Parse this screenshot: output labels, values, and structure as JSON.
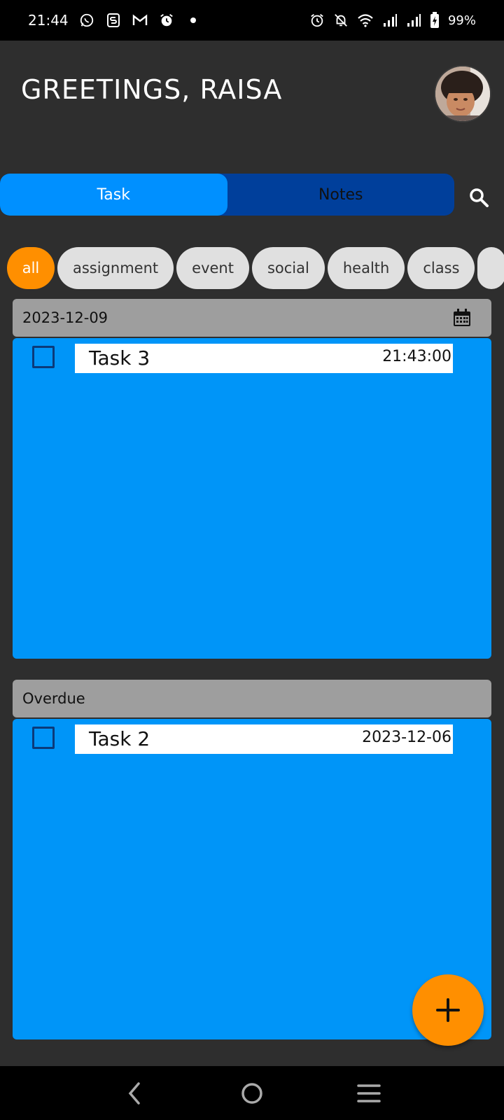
{
  "status_bar": {
    "time": "21:44",
    "battery": "99%",
    "left_icons": [
      "whatsapp-icon",
      "s-icon",
      "gmail-icon",
      "alarm-icon",
      "dot-icon"
    ],
    "right_icons": [
      "alarm-icon",
      "bell-off-icon",
      "wifi-icon",
      "signal-icon",
      "signal-icon",
      "battery-charging-icon"
    ]
  },
  "header": {
    "greeting": "GREETINGS, RAISA"
  },
  "tabs": [
    {
      "label": "Task",
      "active": true
    },
    {
      "label": "Notes",
      "active": false
    }
  ],
  "filters": {
    "chips": [
      "all",
      "assignment",
      "event",
      "social",
      "health",
      "class"
    ],
    "selected": "all"
  },
  "sections": [
    {
      "header": "2023-12-09",
      "tasks": [
        {
          "title": "Task 3",
          "meta": "21:43:00",
          "checked": false
        }
      ]
    },
    {
      "header": "Overdue",
      "tasks": [
        {
          "title": "Task 2",
          "meta": "2023-12-06",
          "checked": false
        }
      ]
    }
  ],
  "colors": {
    "background": "#2e2e2e",
    "accent_blue": "#0095f8",
    "tab_active": "#0090ff",
    "tab_inactive": "#003f9b",
    "orange": "#ff8f00",
    "section_header": "#9e9e9e"
  }
}
